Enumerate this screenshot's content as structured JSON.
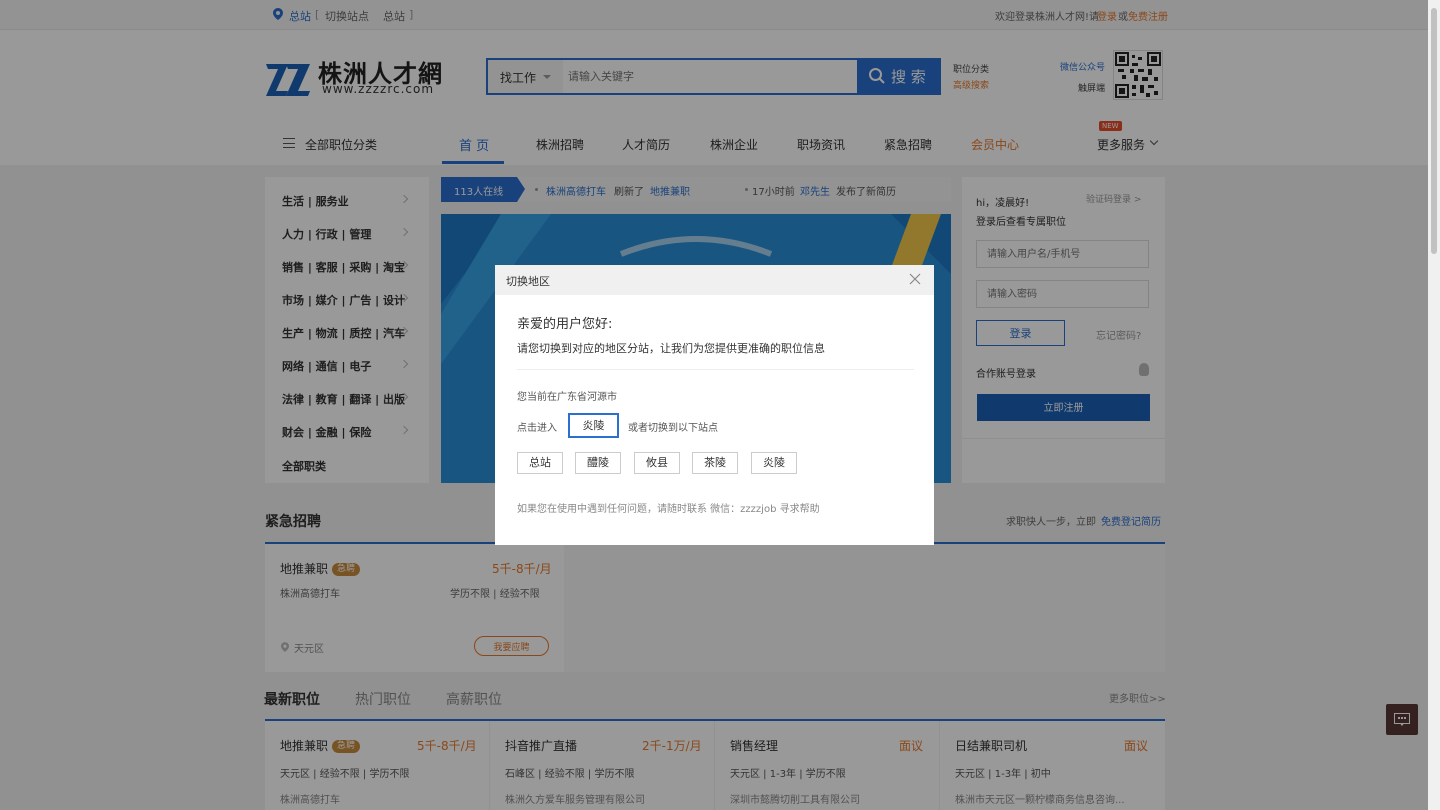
{
  "topbar": {
    "location": "总站",
    "switch_label": "切换站点",
    "current_site": "总站",
    "welcome": "欢迎登录株洲人才网!请",
    "login": "登录",
    "or": "或",
    "register": "免费注册"
  },
  "header": {
    "logo_name": "株洲人才網",
    "logo_url": "www.zzzzrc.com",
    "search_type": "找工作",
    "search_placeholder": "请输入关键字",
    "search_button": "搜 索",
    "job_category": "职位分类",
    "advanced_search": "高级搜索",
    "wechat": "微信公众号",
    "mobile": "触屏端"
  },
  "nav": {
    "all_categories": "全部职位分类",
    "tabs": [
      "首 页",
      "株洲招聘",
      "人才简历",
      "株洲企业",
      "职场资讯",
      "紧急招聘",
      "会员中心"
    ],
    "more": "更多服务",
    "new_badge": "NEW"
  },
  "sidebar": {
    "items": [
      "生活 | 服务业",
      "人力 | 行政 | 管理",
      "销售 | 客服 | 采购 | 淘宝",
      "市场 | 媒介 | 广告 | 设计",
      "生产 | 物流 | 质控 | 汽车",
      "网络 | 通信 | 电子",
      "法律 | 教育 | 翻译 | 出版",
      "财会 | 金融 | 保险",
      "全部职类"
    ]
  },
  "ticker": {
    "online": "113人在线",
    "item1_company": "株洲高德打车",
    "item1_action": "刷新了",
    "item1_job": "地推兼职",
    "item2_time": "17小时前",
    "item2_user": "邓先生",
    "item2_action": "发布了新简历"
  },
  "login_panel": {
    "greeting": "hi，凌晨好!",
    "code_login": "验证码登录 >",
    "subtitle": "登录后查看专属职位",
    "username_placeholder": "请输入用户名/手机号",
    "password_placeholder": "请输入密码",
    "login_button": "登录",
    "forgot": "忘记密码?",
    "partner_login": "合作账号登录",
    "register_button": "立即注册"
  },
  "urgent": {
    "title": "紧急招聘",
    "hint": "求职快人一步，立即",
    "hint_link": "免费登记简历",
    "job_title": "地推兼职",
    "badge": "急聘",
    "salary": "5千-8千/月",
    "company": "株洲高德打车",
    "meta": "学历不限 | 经验不限",
    "location": "天元区",
    "apply": "我要应聘"
  },
  "latest": {
    "tabs": [
      "最新职位",
      "热门职位",
      "高薪职位"
    ],
    "more": "更多职位>>",
    "jobs": [
      {
        "title": "地推兼职",
        "badge": "急聘",
        "salary": "5千-8千/月",
        "meta": "天元区 | 经验不限 | 学历不限",
        "company": "株洲高德打车"
      },
      {
        "title": "抖音推广直播",
        "badge": "",
        "salary": "2千-1万/月",
        "meta": "石峰区 | 经验不限 | 学历不限",
        "company": "株洲久方爱车服务管理有限公司"
      },
      {
        "title": "销售经理",
        "badge": "",
        "salary": "面议",
        "meta": "天元区 | 1-3年 | 学历不限",
        "company": "深圳市懿腾切削工具有限公司"
      },
      {
        "title": "日结兼职司机",
        "badge": "",
        "salary": "面议",
        "meta": "天元区 | 1-3年 | 初中",
        "company": "株洲市天元区一颗柠檬商务信息咨询..."
      }
    ]
  },
  "modal": {
    "title": "切换地区",
    "greeting": "亲爱的用户您好:",
    "message": "请您切换到对应的地区分站，让我们为您提供更准确的职位信息",
    "current_location": "您当前在广东省河源市",
    "click_enter": "点击进入",
    "suggest_site": "炎陵",
    "or_switch": "或者切换到以下站点",
    "sites": [
      "总站",
      "醴陵",
      "攸县",
      "茶陵",
      "炎陵"
    ],
    "help": "如果您在使用中遇到任何问题，请随时联系 微信：zzzzjob 寻求帮助"
  },
  "colors": {
    "accent": "#2b6fcf",
    "orange": "#e6792b",
    "brand_blue": "#1c5fb8"
  }
}
